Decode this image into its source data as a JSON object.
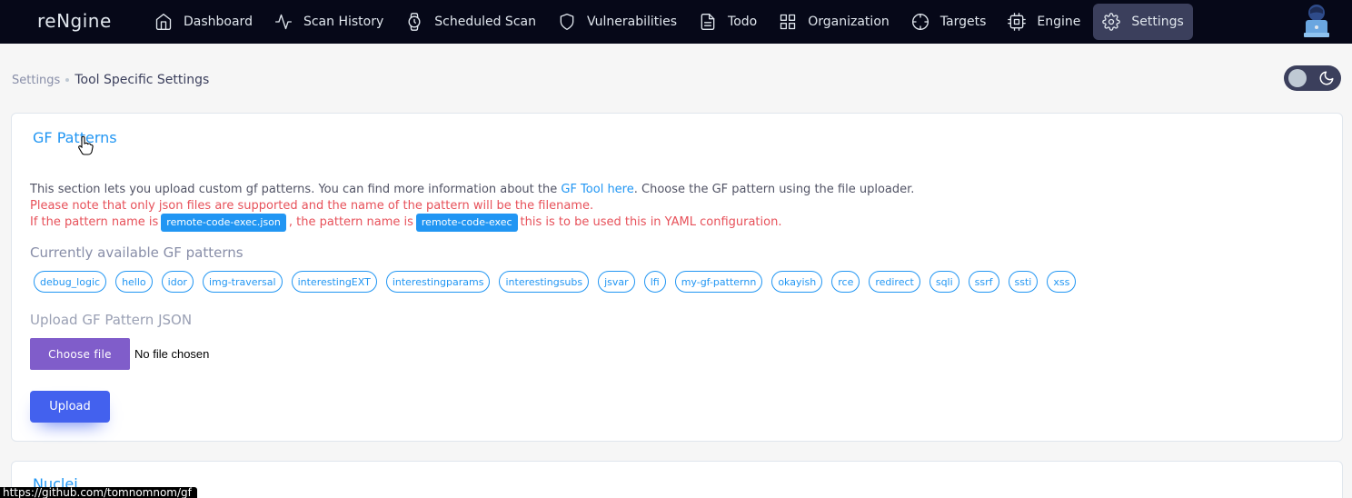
{
  "app": {
    "brand": "reNgine"
  },
  "nav": {
    "items": [
      {
        "label": "Dashboard",
        "icon": "home-icon"
      },
      {
        "label": "Scan History",
        "icon": "activity-icon"
      },
      {
        "label": "Scheduled Scan",
        "icon": "watch-icon"
      },
      {
        "label": "Vulnerabilities",
        "icon": "shield-icon"
      },
      {
        "label": "Todo",
        "icon": "file-text-icon"
      },
      {
        "label": "Organization",
        "icon": "grid-icon"
      },
      {
        "label": "Targets",
        "icon": "crosshair-icon"
      },
      {
        "label": "Engine",
        "icon": "cpu-icon"
      },
      {
        "label": "Settings",
        "icon": "settings-icon",
        "active": true
      }
    ]
  },
  "breadcrumb": {
    "parent": "Settings",
    "current": "Tool Specific Settings"
  },
  "gf": {
    "title": "GF Patterns",
    "description_pre": "This section lets you upload custom gf patterns. You can find more information about the ",
    "description_link": "GF Tool here",
    "description_post": ". Choose the GF pattern using the file uploader.",
    "warning1": "Please note that only json files are supported and the name of the pattern will be the filename.",
    "warning2_pre": "If the pattern name is",
    "warning2_code1": "remote-code-exec.json",
    "warning2_mid": ", the pattern name is",
    "warning2_code2": "remote-code-exec",
    "warning2_post": "this is to be used this in YAML configuration.",
    "available_label": "Currently available GF patterns",
    "patterns": [
      "debug_logic",
      "hello",
      "idor",
      "img-traversal",
      "interestingEXT",
      "interestingparams",
      "interestingsubs",
      "jsvar",
      "lfi",
      "my-gf-patternn",
      "okayish",
      "rce",
      "redirect",
      "sqli",
      "ssrf",
      "ssti",
      "xss"
    ],
    "upload_label": "Upload GF Pattern JSON",
    "choose_file": "Choose file",
    "no_file": "No file chosen",
    "upload_button": "Upload"
  },
  "nuclei": {
    "title": "Nuclei"
  },
  "status_url": "https://github.com/tomnomnom/gf",
  "colors": {
    "accent": "#2196f3",
    "primary": "#4361ee",
    "secondary": "#805dca",
    "danger": "#e7515a",
    "navbar": "#060818"
  }
}
